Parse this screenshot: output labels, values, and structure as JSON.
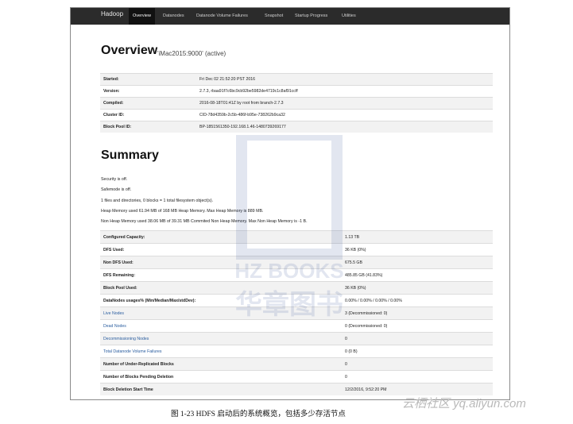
{
  "nav": {
    "brand": "Hadoop",
    "items": [
      "Overview",
      "Datanodes",
      "Datanode Volume Failures",
      "Snapshot",
      "Startup Progress",
      "Utilities"
    ]
  },
  "overview": {
    "title": "Overview",
    "subtitle": "'iMac2015:9000' (active)",
    "rows": [
      {
        "k": "Started:",
        "v": "Fri Dec 02 21:52:20 PST 2016"
      },
      {
        "k": "Version:",
        "v": "2.7.3, rbaa91f7c6bc9cb92be5982de4719c1c8af91ccff"
      },
      {
        "k": "Compiled:",
        "v": "2016-08-18T01:41Z by root from branch-2.7.3"
      },
      {
        "k": "Cluster ID:",
        "v": "CID-78d4359b-2c5b-486f-b95e-738262b9ca32"
      },
      {
        "k": "Block Pool ID:",
        "v": "BP-1851561350-192.168.1.46-1480739269177"
      }
    ]
  },
  "summary": {
    "title": "Summary",
    "lines": [
      "Security is off.",
      "Safemode is off.",
      "1 files and directories, 0 blocks = 1 total filesystem object(s).",
      "Heap Memory used 61.94 MB of 168 MB Heap Memory. Max Heap Memory is 889 MB.",
      "Non Heap Memory used 38.06 MB of 39.31 MB Commited Non Heap Memory. Max Non Heap Memory is -1 B."
    ],
    "rows": [
      {
        "k": "Configured Capacity:",
        "v": "1.13 TB"
      },
      {
        "k": "DFS Used:",
        "v": "36 KB (0%)"
      },
      {
        "k": "Non DFS Used:",
        "v": "675.5 GB"
      },
      {
        "k": "DFS Remaining:",
        "v": "485.85 GB (41.83%)"
      },
      {
        "k": "Block Pool Used:",
        "v": "36 KB (0%)"
      },
      {
        "k": "DataNodes usages% (Min/Median/Max/stdDev):",
        "v": "0.00% / 0.00% / 0.00% / 0.00%"
      },
      {
        "k": "Live Nodes",
        "v": "3 (Decommissioned: 0)"
      },
      {
        "k": "Dead Nodes",
        "v": "0 (Decommissioned: 0)"
      },
      {
        "k": "Decommissioning Nodes",
        "v": "0"
      },
      {
        "k": "Total Datanode Volume Failures",
        "v": "0 (0 B)"
      },
      {
        "k": "Number of Under-Replicated Blocks",
        "v": "0"
      },
      {
        "k": "Number of Blocks Pending Deletion",
        "v": "0"
      },
      {
        "k": "Block Deletion Start Time",
        "v": "12/2/2016, 9:52:20 PM"
      }
    ]
  },
  "watermark": "HZ BOOKS 华章图书",
  "caption": "图 1-23    HDFS 启动后的系统概览，包括多少存活节点",
  "site_mark": "云栖社区 yq.aliyun.com"
}
